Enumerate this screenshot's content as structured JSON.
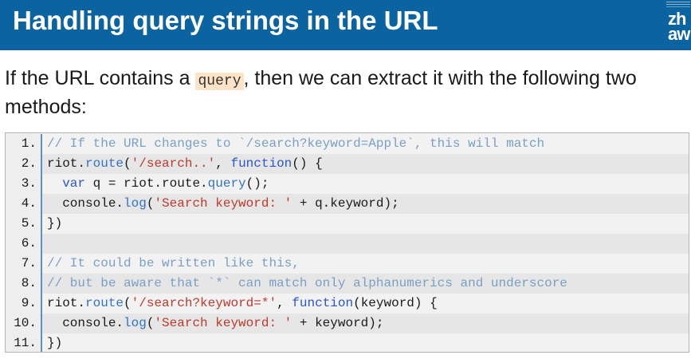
{
  "header": {
    "title": "Handling query strings in the URL",
    "logo_text": "zh\naw"
  },
  "intro": {
    "text_before": "If the URL contains a ",
    "code": "query",
    "text_after": ", then we can extract it with the following two methods:"
  },
  "code_lines": [
    {
      "num": "1.",
      "comment": "// If the URL changes to `/search?keyword=Apple`, this will match"
    },
    {
      "num": "2.",
      "p1": "riot.",
      "fn": "route",
      "p2": "(",
      "str": "'/search..'",
      "p3": ", ",
      "kw": "function",
      "p4": "() {"
    },
    {
      "num": "3.",
      "p1": "  ",
      "kw": "var",
      "p2": " q = riot.route.",
      "fn": "query",
      "p3": "();"
    },
    {
      "num": "4.",
      "p1": "  console.",
      "fn": "log",
      "p2": "(",
      "str": "'Search keyword: '",
      "p3": " + q.keyword);"
    },
    {
      "num": "5.",
      "text": "})"
    },
    {
      "num": "6.",
      "text": ""
    },
    {
      "num": "7.",
      "comment": "// It could be written like this,"
    },
    {
      "num": "8.",
      "comment": "// but be aware that `*` can match only alphanumerics and underscore"
    },
    {
      "num": "9.",
      "p1": "riot.",
      "fn": "route",
      "p2": "(",
      "str": "'/search?keyword=*'",
      "p3": ", ",
      "kw": "function",
      "p4": "(keyword) {"
    },
    {
      "num": "10.",
      "p1": "  console.",
      "fn": "log",
      "p2": "(",
      "str": "'Search keyword: '",
      "p3": " + keyword);"
    },
    {
      "num": "11.",
      "text": "})"
    }
  ],
  "colors": {
    "header_bg": "#0b64a0",
    "inline_code_bg": "#fde3c8",
    "comment": "#7a9fc4",
    "function": "#3373c4",
    "keyword": "#2b55c8",
    "string": "#c0392b"
  }
}
